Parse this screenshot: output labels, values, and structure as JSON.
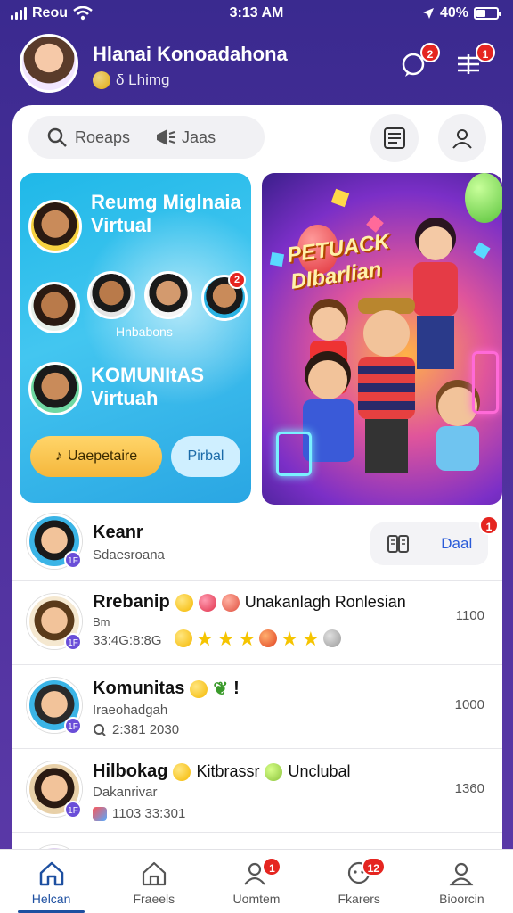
{
  "status": {
    "carrier": "Reou",
    "time": "3:13 AM",
    "battery": "40%",
    "battery_level": 0.4
  },
  "header": {
    "name": "Hlanai Konoadahona",
    "status_text": "δ Lhimg",
    "notif_badge": "2",
    "menu_badge": "1"
  },
  "search": {
    "placeholder": "Roeaps",
    "secondary": "Jaas"
  },
  "card_left": {
    "title1_line1": "Reumg Miglnaia",
    "title1_line2": "Virtual",
    "group_label": "Hnbabons",
    "group_badge": "2",
    "title2_line1": "KOMUNItAS",
    "title2_line2": "Virtuah",
    "btn_primary": "Uaepetaire",
    "btn_secondary": "Pirbal"
  },
  "card_right": {
    "poster_line1": "PETUACK",
    "poster_line2": "DIbarlian"
  },
  "feature_row": {
    "title": "Keanr",
    "subtitle": "Sdaesroana",
    "action_label": "Daal",
    "action_badge": "1",
    "mini_badge": "1F"
  },
  "list": [
    {
      "title": "Rrebanip",
      "title_extra": "Unakanlagh Ronlesian",
      "line2": "Bm",
      "line3": "33:4G:8:8G",
      "time": "1100",
      "mini_badge": "1F",
      "stars": 5
    },
    {
      "title": "Komunitas",
      "title_extra": "!",
      "line2": "Iraeohadgah",
      "line3": "2:381 2030",
      "time": "1000",
      "mini_badge": "1F"
    },
    {
      "title": "Hilbokag",
      "title_extra": "Kitbrassr",
      "title_extra2": "Unclubal",
      "line2": "Dakanrivar",
      "line3": "1103 33:301",
      "time": "1360",
      "mini_badge": "1F"
    }
  ],
  "tabs": [
    {
      "label": "Helcan",
      "icon": "home-icon",
      "badge": ""
    },
    {
      "label": "Fraeels",
      "icon": "store-icon",
      "badge": ""
    },
    {
      "label": "Uomtem",
      "icon": "people-icon",
      "badge": "1"
    },
    {
      "label": "Fkarers",
      "icon": "chat-icon",
      "badge": "12"
    },
    {
      "label": "Bioorcin",
      "icon": "profile-icon",
      "badge": ""
    }
  ],
  "colors": {
    "bg_top": "#3a2a8f",
    "accent_blue": "#1d4fa0",
    "badge_red": "#e52520",
    "card_cyan": "#1fb8e8"
  }
}
